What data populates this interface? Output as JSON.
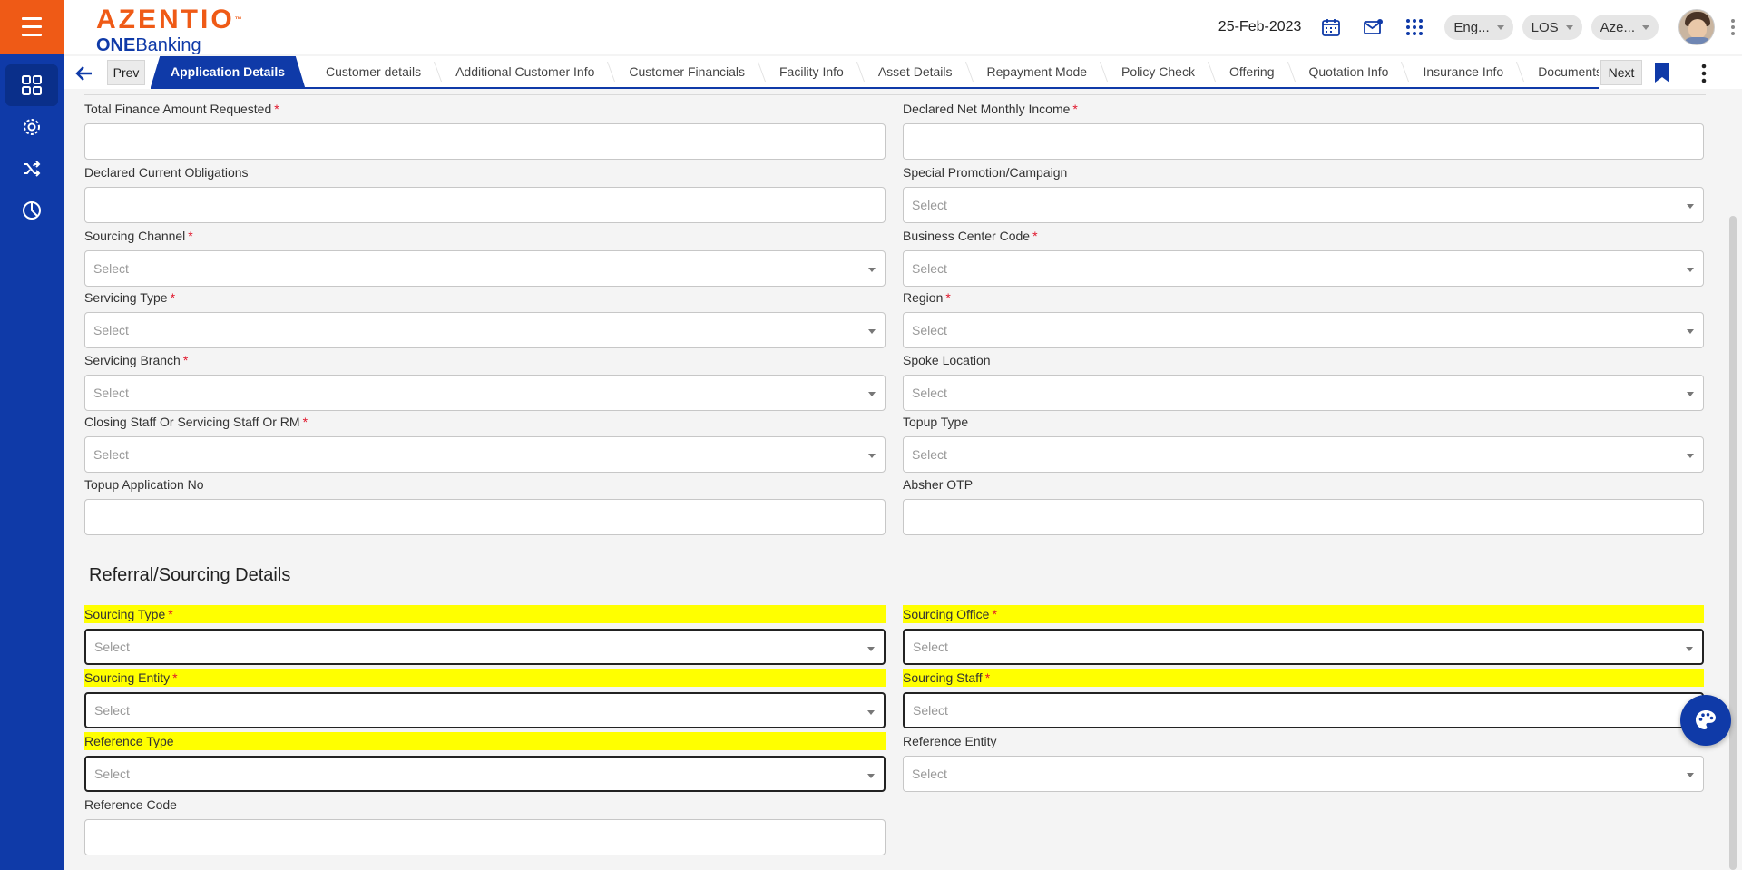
{
  "header": {
    "brand": "AZENTIO",
    "brand_tm": "™",
    "sub_bold": "ONE",
    "sub_rest": "Banking",
    "date": "25-Feb-2023",
    "language": "Eng...",
    "module": "LOS",
    "entity": "Aze...",
    "icons": [
      "calendar-icon",
      "mail-icon",
      "apps-grid-icon",
      "kebab-icon"
    ]
  },
  "rail": {
    "items": [
      "dashboard-icon",
      "settings-icon",
      "shuffle-icon",
      "pie-chart-icon"
    ]
  },
  "tabbar": {
    "prev": "Prev",
    "next": "Next",
    "tabs": [
      "Application Details",
      "Customer details",
      "Additional Customer Info",
      "Customer Financials",
      "Facility Info",
      "Asset Details",
      "Repayment Mode",
      "Policy Check",
      "Offering",
      "Quotation Info",
      "Insurance Info",
      "Documents"
    ],
    "active_index": 0
  },
  "form": {
    "required_mark": "*",
    "placeholder": "Select",
    "fields": {
      "total_finance": "Total Finance Amount Requested",
      "declared_income": "Declared Net Monthly Income",
      "current_obligations": "Declared Current Obligations",
      "promotion": "Special Promotion/Campaign",
      "sourcing_channel": "Sourcing Channel",
      "business_center": "Business Center Code",
      "servicing_type": "Servicing Type",
      "region": "Region",
      "servicing_branch": "Servicing Branch",
      "spoke_location": "Spoke Location",
      "closing_staff": "Closing Staff Or Servicing Staff Or RM",
      "topup_type": "Topup Type",
      "topup_app_no": "Topup Application No",
      "absher_otp": "Absher OTP"
    }
  },
  "referral": {
    "title": "Referral/Sourcing Details",
    "fields": {
      "sourcing_type": "Sourcing Type",
      "sourcing_office": "Sourcing Office",
      "sourcing_entity": "Sourcing Entity",
      "sourcing_staff": "Sourcing Staff",
      "reference_type": "Reference Type",
      "reference_entity": "Reference Entity",
      "reference_code": "Reference Code"
    }
  },
  "colors": {
    "primary": "#0f3aa8",
    "brand_orange": "#ef5a16",
    "highlight": "#ffff00",
    "required": "#e0162b"
  }
}
